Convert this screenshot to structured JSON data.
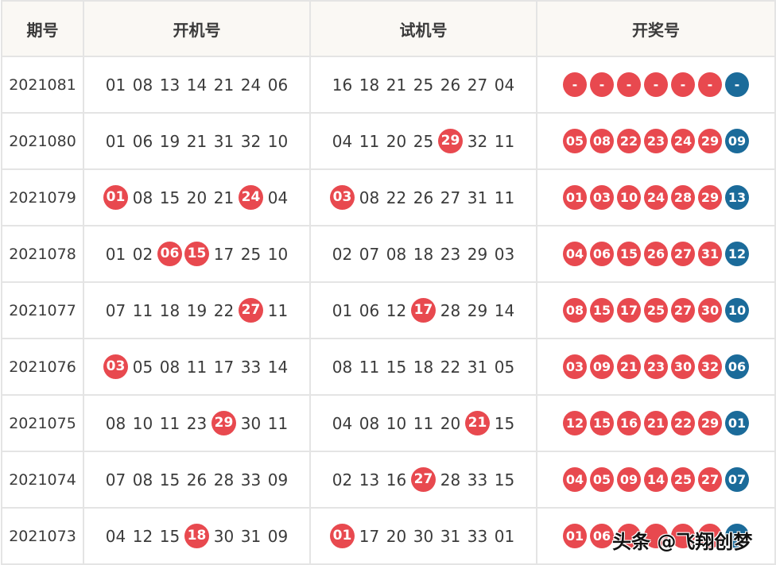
{
  "headers": {
    "issue": "期号",
    "open": "开机号",
    "test": "试机号",
    "win": "开奖号"
  },
  "colors": {
    "red_ball": "#e8494f",
    "blue_ball": "#1b6b9a",
    "header_bg": "#faf8f4",
    "border": "#e4e4e4"
  },
  "rows": [
    {
      "issue": "2021081",
      "open": [
        {
          "n": "01"
        },
        {
          "n": "08"
        },
        {
          "n": "13"
        },
        {
          "n": "14"
        },
        {
          "n": "21"
        },
        {
          "n": "24"
        },
        {
          "n": "06"
        }
      ],
      "test": [
        {
          "n": "16"
        },
        {
          "n": "18"
        },
        {
          "n": "21"
        },
        {
          "n": "25"
        },
        {
          "n": "26"
        },
        {
          "n": "27"
        },
        {
          "n": "04"
        }
      ],
      "win_red": [
        "-",
        "-",
        "-",
        "-",
        "-",
        "-"
      ],
      "win_blue": "-"
    },
    {
      "issue": "2021080",
      "open": [
        {
          "n": "01"
        },
        {
          "n": "06"
        },
        {
          "n": "19"
        },
        {
          "n": "21"
        },
        {
          "n": "31"
        },
        {
          "n": "32"
        },
        {
          "n": "10"
        }
      ],
      "test": [
        {
          "n": "04"
        },
        {
          "n": "11"
        },
        {
          "n": "20"
        },
        {
          "n": "25"
        },
        {
          "n": "29",
          "hit": true
        },
        {
          "n": "32"
        },
        {
          "n": "11"
        }
      ],
      "win_red": [
        "05",
        "08",
        "22",
        "23",
        "24",
        "29"
      ],
      "win_blue": "09"
    },
    {
      "issue": "2021079",
      "open": [
        {
          "n": "01",
          "hit": true
        },
        {
          "n": "08"
        },
        {
          "n": "15"
        },
        {
          "n": "20"
        },
        {
          "n": "21"
        },
        {
          "n": "24",
          "hit": true
        },
        {
          "n": "04"
        }
      ],
      "test": [
        {
          "n": "03",
          "hit": true
        },
        {
          "n": "08"
        },
        {
          "n": "22"
        },
        {
          "n": "26"
        },
        {
          "n": "27"
        },
        {
          "n": "31"
        },
        {
          "n": "11"
        }
      ],
      "win_red": [
        "01",
        "03",
        "10",
        "24",
        "28",
        "29"
      ],
      "win_blue": "13"
    },
    {
      "issue": "2021078",
      "open": [
        {
          "n": "01"
        },
        {
          "n": "02"
        },
        {
          "n": "06",
          "hit": true
        },
        {
          "n": "15",
          "hit": true
        },
        {
          "n": "17"
        },
        {
          "n": "25"
        },
        {
          "n": "10"
        }
      ],
      "test": [
        {
          "n": "02"
        },
        {
          "n": "07"
        },
        {
          "n": "08"
        },
        {
          "n": "18"
        },
        {
          "n": "23"
        },
        {
          "n": "29"
        },
        {
          "n": "03"
        }
      ],
      "win_red": [
        "04",
        "06",
        "15",
        "26",
        "27",
        "31"
      ],
      "win_blue": "12"
    },
    {
      "issue": "2021077",
      "open": [
        {
          "n": "07"
        },
        {
          "n": "11"
        },
        {
          "n": "18"
        },
        {
          "n": "19"
        },
        {
          "n": "22"
        },
        {
          "n": "27",
          "hit": true
        },
        {
          "n": "11"
        }
      ],
      "test": [
        {
          "n": "01"
        },
        {
          "n": "06"
        },
        {
          "n": "12"
        },
        {
          "n": "17",
          "hit": true
        },
        {
          "n": "28"
        },
        {
          "n": "29"
        },
        {
          "n": "14"
        }
      ],
      "win_red": [
        "08",
        "15",
        "17",
        "25",
        "27",
        "30"
      ],
      "win_blue": "10"
    },
    {
      "issue": "2021076",
      "open": [
        {
          "n": "03",
          "hit": true
        },
        {
          "n": "05"
        },
        {
          "n": "08"
        },
        {
          "n": "11"
        },
        {
          "n": "17"
        },
        {
          "n": "33"
        },
        {
          "n": "14"
        }
      ],
      "test": [
        {
          "n": "08"
        },
        {
          "n": "11"
        },
        {
          "n": "15"
        },
        {
          "n": "18"
        },
        {
          "n": "22"
        },
        {
          "n": "31"
        },
        {
          "n": "05"
        }
      ],
      "win_red": [
        "03",
        "09",
        "21",
        "23",
        "30",
        "32"
      ],
      "win_blue": "06"
    },
    {
      "issue": "2021075",
      "open": [
        {
          "n": "08"
        },
        {
          "n": "10"
        },
        {
          "n": "11"
        },
        {
          "n": "23"
        },
        {
          "n": "29",
          "hit": true
        },
        {
          "n": "30"
        },
        {
          "n": "11"
        }
      ],
      "test": [
        {
          "n": "04"
        },
        {
          "n": "08"
        },
        {
          "n": "10"
        },
        {
          "n": "11"
        },
        {
          "n": "20"
        },
        {
          "n": "21",
          "hit": true
        },
        {
          "n": "15"
        }
      ],
      "win_red": [
        "12",
        "15",
        "16",
        "21",
        "22",
        "29"
      ],
      "win_blue": "01"
    },
    {
      "issue": "2021074",
      "open": [
        {
          "n": "07"
        },
        {
          "n": "08"
        },
        {
          "n": "15"
        },
        {
          "n": "26"
        },
        {
          "n": "28"
        },
        {
          "n": "33"
        },
        {
          "n": "09"
        }
      ],
      "test": [
        {
          "n": "02"
        },
        {
          "n": "13"
        },
        {
          "n": "16"
        },
        {
          "n": "27",
          "hit": true
        },
        {
          "n": "28"
        },
        {
          "n": "33"
        },
        {
          "n": "15"
        }
      ],
      "win_red": [
        "04",
        "05",
        "09",
        "14",
        "25",
        "27"
      ],
      "win_blue": "07"
    },
    {
      "issue": "2021073",
      "open": [
        {
          "n": "04"
        },
        {
          "n": "12"
        },
        {
          "n": "15"
        },
        {
          "n": "18",
          "hit": true
        },
        {
          "n": "30"
        },
        {
          "n": "31"
        },
        {
          "n": "09"
        }
      ],
      "test": [
        {
          "n": "01",
          "hit": true
        },
        {
          "n": "17"
        },
        {
          "n": "20"
        },
        {
          "n": "30"
        },
        {
          "n": "31"
        },
        {
          "n": "33"
        },
        {
          "n": "01"
        }
      ],
      "win_red": [
        "01",
        "06",
        "",
        "",
        "",
        ""
      ],
      "win_blue": ""
    }
  ],
  "watermark": "头条 @飞翔创梦"
}
